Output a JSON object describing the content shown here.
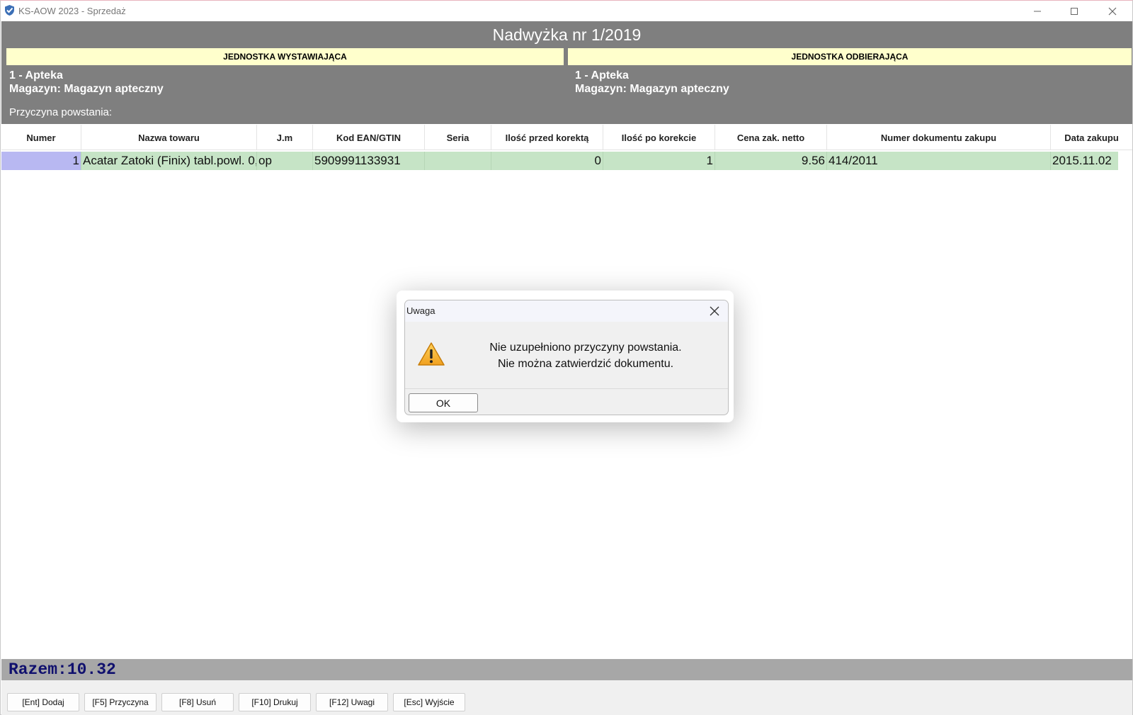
{
  "window": {
    "title": "KS-AOW 2023 - Sprzedaż",
    "app_icon": "check-shield-icon"
  },
  "header": {
    "document_title": "Nadwyżka nr 1/2019",
    "issuing_unit_label": "JEDNOSTKA WYSTAWIAJĄCA",
    "receiving_unit_label": "JEDNOSTKA ODBIERAJĄCA",
    "issuing_unit_name": "1 - Apteka",
    "issuing_unit_warehouse": "Magazyn: Magazyn apteczny",
    "receiving_unit_name": "1 - Apteka",
    "receiving_unit_warehouse": "Magazyn: Magazyn apteczny",
    "reason_label": "Przyczyna powstania:"
  },
  "table": {
    "columns": [
      "Numer",
      "Nazwa towaru",
      "J.m",
      "Kod EAN/GTIN",
      "Seria",
      "Ilość przed korektą",
      "Ilość po korekcie",
      "Cena zak. netto",
      "Numer dokumentu zakupu",
      "Data zakupu"
    ],
    "rows": [
      {
        "numer": "1",
        "nazwa": "Acatar Zatoki (Finix) tabl.powl. 0,",
        "jm": "op",
        "ean": "5909991133931",
        "seria": "",
        "ilosc_przed": "0",
        "ilosc_po": "1",
        "cena": "9.56",
        "nr_dok": "414/2011",
        "data": "2015.11.02"
      }
    ]
  },
  "total": {
    "text": "Razem:10.32"
  },
  "footer": {
    "buttons": [
      "[Ent] Dodaj",
      "[F5] Przyczyna",
      "[F8] Usuń",
      "[F10] Drukuj",
      "[F12] Uwagi",
      "[Esc] Wyjście"
    ]
  },
  "dialog": {
    "title": "Uwaga",
    "message_line1": "Nie uzupełniono przyczyny powstania.",
    "message_line2": "Nie można zatwierdzić dokumentu.",
    "ok_label": "OK",
    "icon": "warning-icon"
  },
  "colors": {
    "header_bg": "#7f7f7f",
    "unit_label_bg": "#ffffcc",
    "row_selected_bg": "#c6e4c6",
    "number_cell_bg": "#b8b8f2",
    "total_text": "#10106e"
  }
}
